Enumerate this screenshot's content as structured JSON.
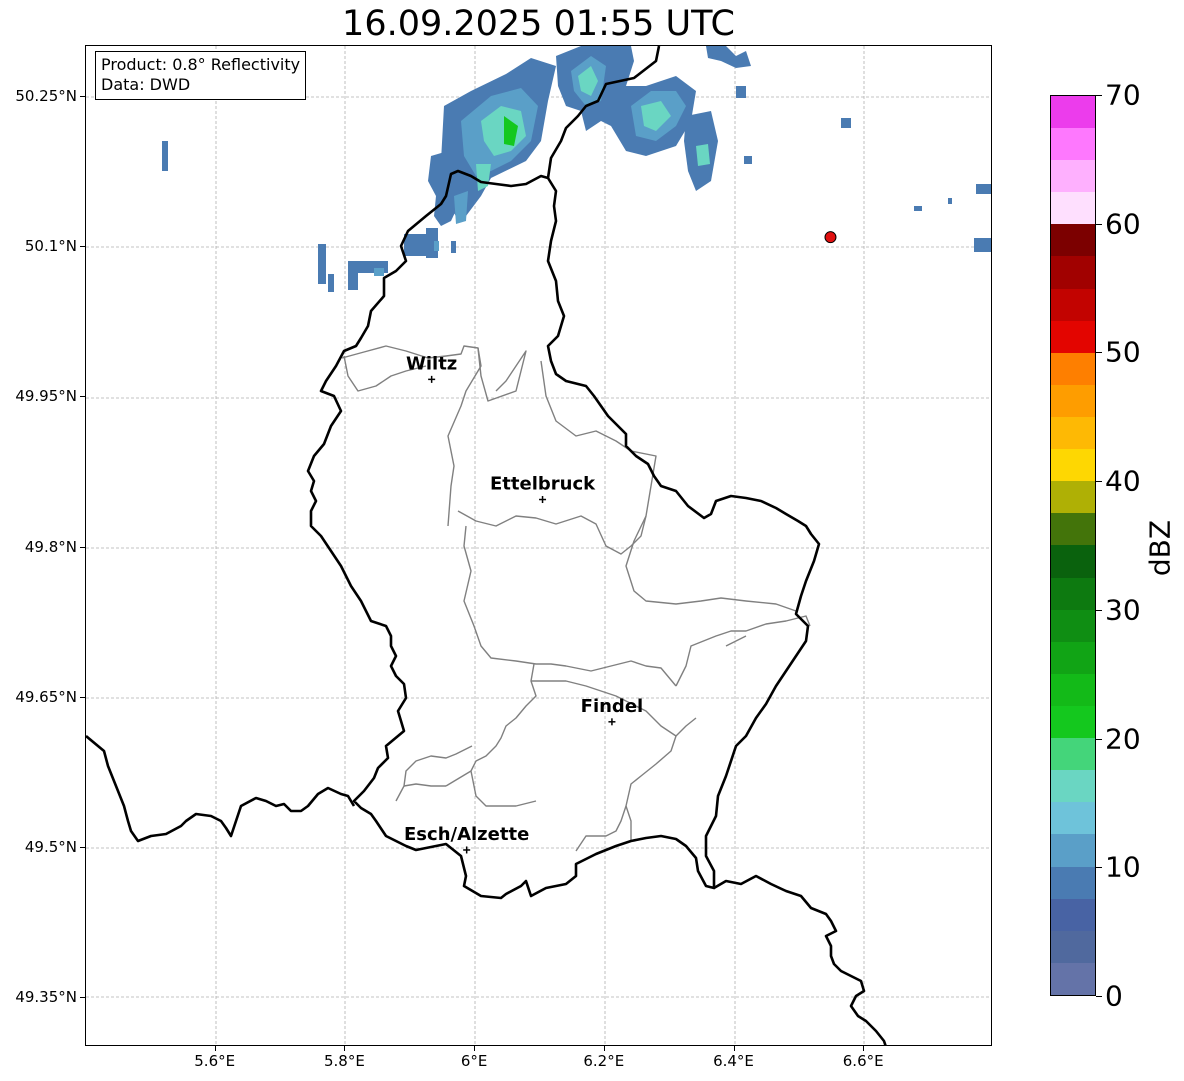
{
  "title": "16.09.2025 01:55 UTC",
  "info": {
    "product": "Product: 0.8° Reflectivity",
    "data": "Data: DWD"
  },
  "lat_ticks": [
    "50.25°N",
    "50.1°N",
    "49.95°N",
    "49.8°N",
    "49.65°N",
    "49.5°N",
    "49.35°N"
  ],
  "lon_ticks": [
    "5.6°E",
    "5.8°E",
    "6°E",
    "6.2°E",
    "6.4°E",
    "6.6°E"
  ],
  "cities": [
    {
      "name": "Wiltz",
      "lat": 49.968,
      "lon": 5.933
    },
    {
      "name": "Ettelbruck",
      "lat": 49.848,
      "lon": 6.104
    },
    {
      "name": "Findel",
      "lat": 49.626,
      "lon": 6.211
    },
    {
      "name": "Esch/Alzette",
      "lat": 49.498,
      "lon": 5.987
    }
  ],
  "radar_site": {
    "lat": 50.11,
    "lon": 6.548,
    "color": "#e01010"
  },
  "colorbar": {
    "label": "dBZ",
    "tick_labels": [
      "0",
      "10",
      "20",
      "30",
      "40",
      "50",
      "60",
      "70"
    ],
    "colors": [
      "#6473a8",
      "#50699e",
      "#4863a4",
      "#4a7bb2",
      "#5a9fc8",
      "#6ec3da",
      "#6ad6c2",
      "#44d57a",
      "#14c81e",
      "#13ba18",
      "#11a415",
      "#0f8e13",
      "#0d7a10",
      "#0a620d",
      "#43740a",
      "#afb005",
      "#fed702",
      "#feb904",
      "#fe9d00",
      "#fe7f00",
      "#e30500",
      "#c20300",
      "#a10100",
      "#7c0000",
      "#fedffe",
      "#feb0fe",
      "#fe78fe",
      "#ec3cec"
    ]
  },
  "map_colors": {
    "country_border": "#000000",
    "canton_border": "#808080",
    "grid": "#b0b0b0"
  }
}
